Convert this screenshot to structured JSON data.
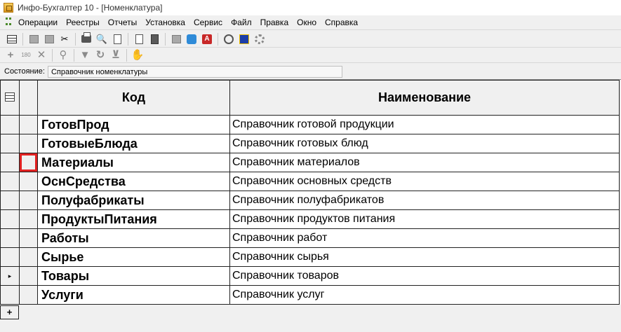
{
  "window": {
    "title": "Инфо-Бухгалтер 10 - [Номенклатура]"
  },
  "menu": {
    "items": [
      "Операции",
      "Реестры",
      "Отчеты",
      "Установка",
      "Сервис",
      "Файл",
      "Правка",
      "Окно",
      "Справка"
    ]
  },
  "toolbar": {
    "icons": [
      "grid-icon",
      "copy-icon",
      "paste-icon",
      "cut-icon",
      "print-icon",
      "preview-icon",
      "export-icon",
      "document-icon",
      "calculator-icon",
      "report-icon",
      "help-icon",
      "acrobat-icon",
      "compass-icon",
      "cube-icon",
      "settings-icon"
    ],
    "secondary_icons": [
      "add-icon",
      "rotate-icon",
      "delete-icon",
      "find-icon",
      "filter-icon",
      "refresh-icon",
      "clear-filter-icon",
      "move-icon"
    ],
    "rotate_label": "180"
  },
  "status": {
    "label": "Состояние:",
    "value": "Справочник номенклатуры"
  },
  "table": {
    "columns": {
      "code": "Код",
      "name": "Наименование"
    },
    "rows": [
      {
        "code": "ГотовПрод",
        "name": "Справочник готовой продукции"
      },
      {
        "code": "ГотовыеБлюда",
        "name": "Справочник готовых блюд"
      },
      {
        "code": "Материалы",
        "name": "Справочник материалов"
      },
      {
        "code": "ОснСредства",
        "name": "Справочник основных средств"
      },
      {
        "code": "Полуфабрикаты",
        "name": "Справочник полуфабрикатов"
      },
      {
        "code": "ПродуктыПитания",
        "name": "Справочник продуктов питания"
      },
      {
        "code": "Работы",
        "name": "Справочник работ"
      },
      {
        "code": "Сырье",
        "name": "Справочник сырья"
      },
      {
        "code": "Товары",
        "name": "Справочник товаров"
      },
      {
        "code": "Услуги",
        "name": "Справочник услуг"
      }
    ],
    "current_row_marker": "▸",
    "new_row_marker": "+",
    "highlight_color": "#e02020"
  }
}
